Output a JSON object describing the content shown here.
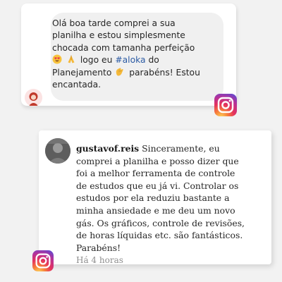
{
  "comment1": {
    "lines": [
      "Olá boa tarde comprei a sua",
      "planilha e estou simplesmente",
      "chocada com tamanha perfeição"
    ],
    "line4_text": "logo eu",
    "hashtag": "#aloka",
    "line4_end": "do",
    "line5_start": "Planejamento",
    "line5_end": "parabéns! Estou",
    "line6": "encantada.",
    "emojis": [
      "heart-eyes-icon",
      "praying-hands-icon",
      "clapping-hands-icon"
    ]
  },
  "comment2": {
    "username": "gustavof.reis",
    "first_line_text": "Sinceramente, eu",
    "lines": [
      "comprei a planilha e posso dizer que",
      "foi a melhor ferramenta de controle",
      "de estudos que eu já vi. Controlar os",
      "estudos por ela reduziu bastante a",
      "minha ansiedade e me deu um novo",
      "gás. Os gráficos, controle de revisões,",
      "de horas líquidas etc. são fantásticos.",
      "Parabéns!"
    ],
    "timestamp": "Há 4 horas"
  },
  "colors": {
    "hashtag": "#2b5aa3",
    "bubble": "#f0f0f0",
    "timestamp": "#8e8e8e"
  }
}
